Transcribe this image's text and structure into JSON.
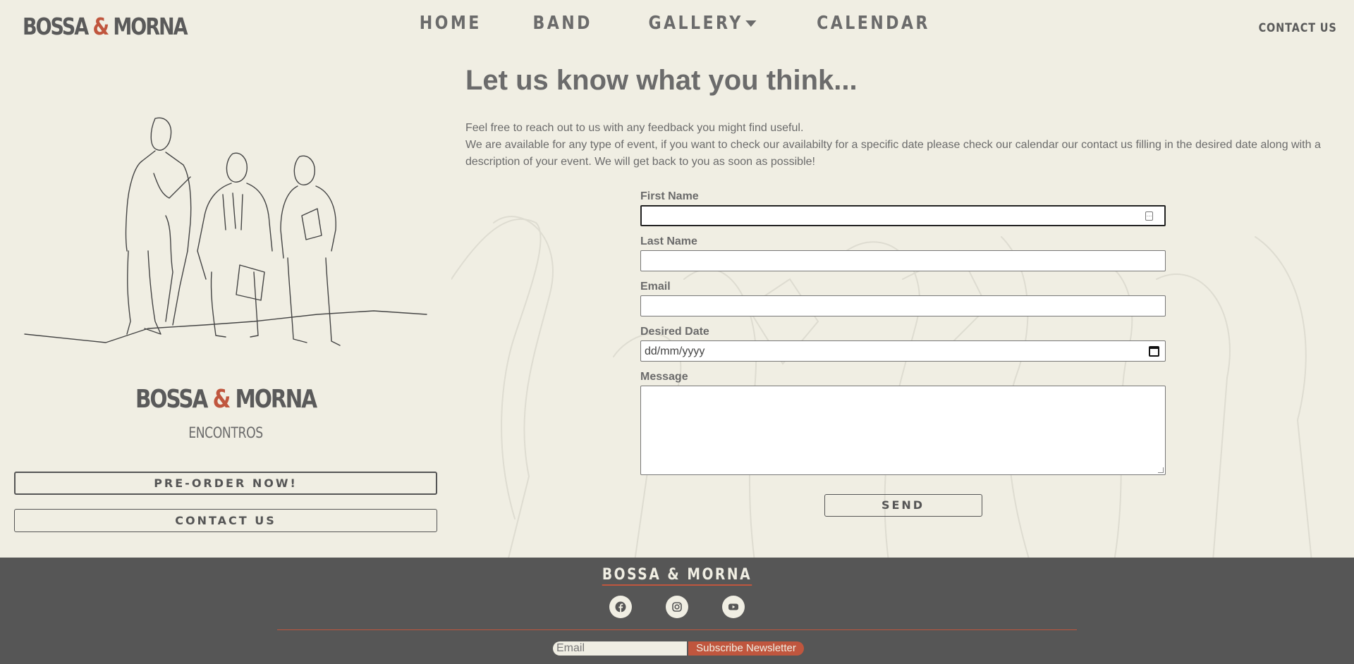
{
  "header": {
    "logo_part1": "BOSSA ",
    "logo_amp": "&",
    "logo_part2": " MORNA",
    "nav": {
      "home": "HOME",
      "band": "BAND",
      "gallery": "GALLERY",
      "calendar": "CALENDAR"
    },
    "contact_label": "CONTACT US"
  },
  "sidebar": {
    "album_part1": "BOSSA ",
    "album_amp": "&",
    "album_part2": " MORNA",
    "album_subtitle": "ENCONTROS",
    "preorder_label": "PRE-ORDER NOW!",
    "contact_label": "CONTACT US"
  },
  "main": {
    "title": "Let us know what you think...",
    "intro_line1": "Feel free to reach out to us with any feedback you might find useful.",
    "intro_line2": "We are available for any type of event, if you want to check our availabilty for a specific date please check our calendar our contact us filling in the desired date along with a description of your event. We will get back to you as soon as possible!"
  },
  "form": {
    "first_name_label": "First Name",
    "first_name_value": "",
    "last_name_label": "Last Name",
    "last_name_value": "",
    "email_label": "Email",
    "email_value": "",
    "date_label": "Desired Date",
    "date_placeholder": "dd/mm/yyyy",
    "message_label": "Message",
    "message_value": "",
    "send_label": "SEND"
  },
  "footer": {
    "brand": "BOSSA & MORNA",
    "social_icons": [
      "facebook-icon",
      "instagram-icon",
      "youtube-icon"
    ],
    "newsletter_placeholder": "Email",
    "subscribe_label": "Subscribe Newsletter"
  },
  "colors": {
    "background": "#f0eee3",
    "text": "#6b6b6b",
    "accent": "#c0563e",
    "footer": "#565656"
  }
}
